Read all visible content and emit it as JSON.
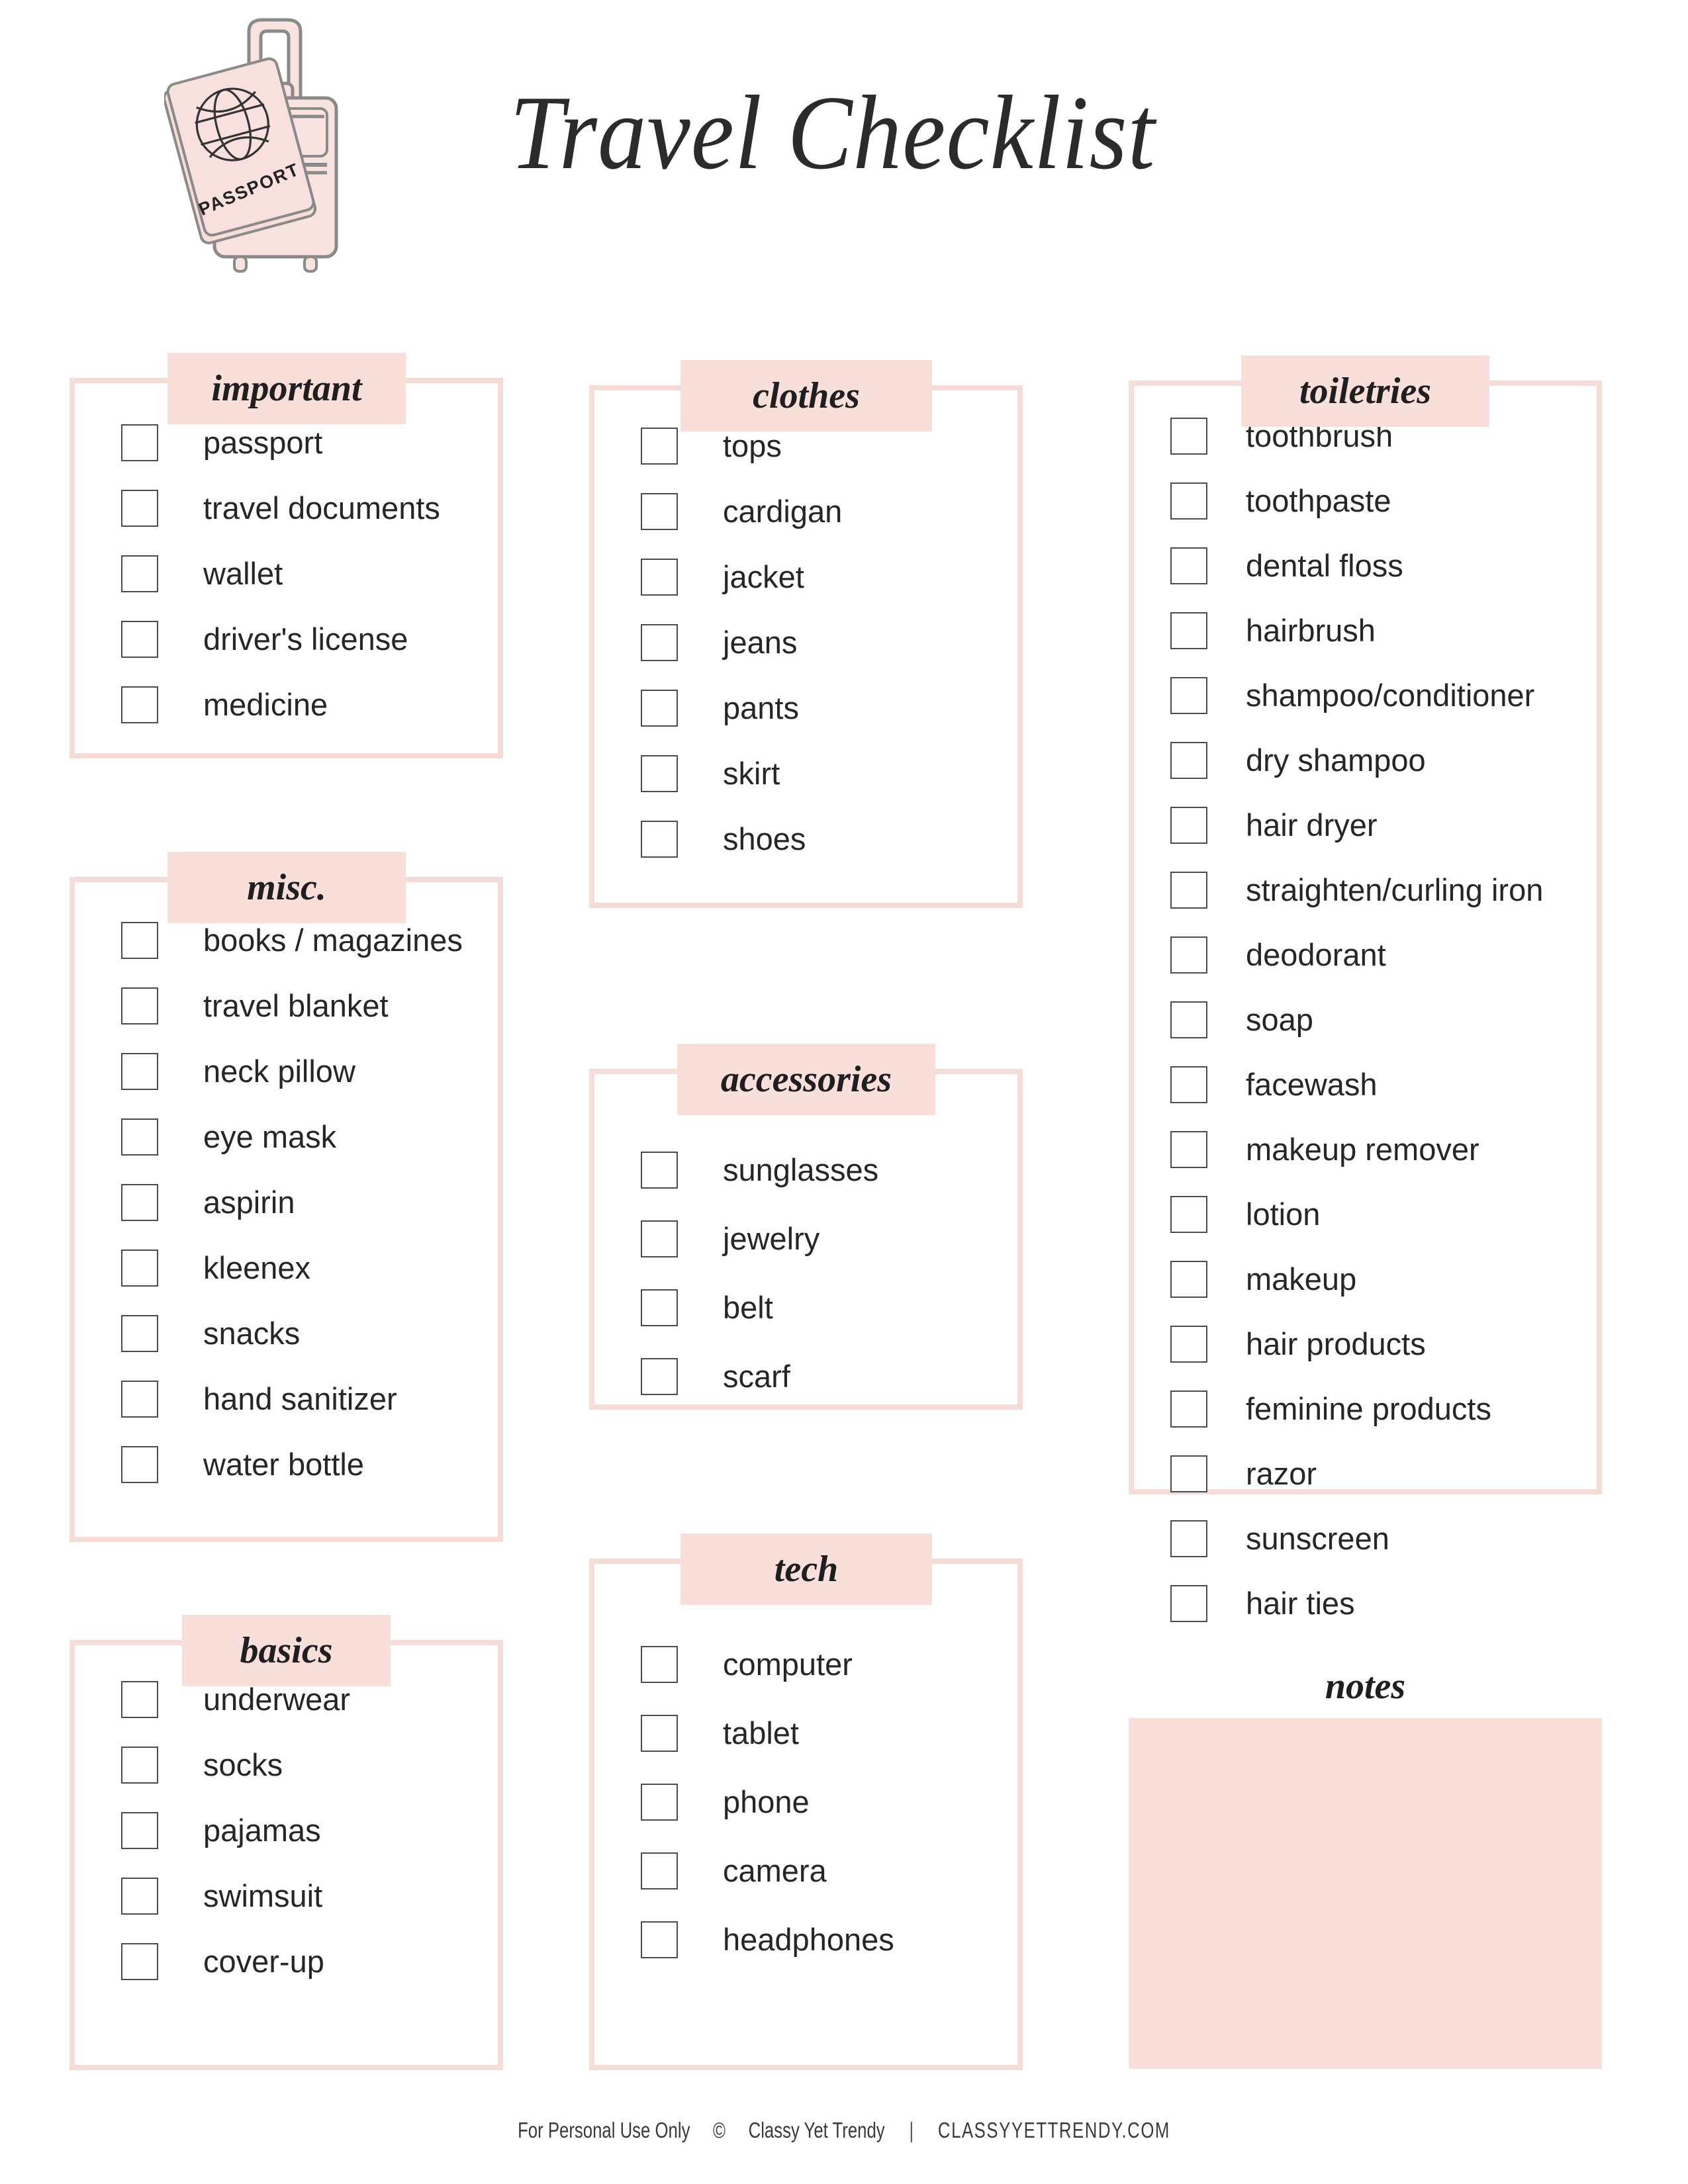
{
  "page": {
    "title": "Travel Checklist",
    "illustration": {
      "name": "passport-suitcase-illustration",
      "passport_label": "PASSPORT"
    }
  },
  "colors": {
    "badge_fill": "#f8dfda",
    "box_border": "#f6dcd7",
    "notes_fill": "#f8dfda",
    "text": "#262626",
    "checkbox_border": "#4a4a4a"
  },
  "sections": [
    {
      "id": "important",
      "title": "important",
      "items": [
        "passport",
        "travel documents",
        "wallet",
        "driver's license",
        "medicine"
      ]
    },
    {
      "id": "misc",
      "title": "misc.",
      "items": [
        "books / magazines",
        "travel blanket",
        "neck pillow",
        "eye mask",
        "aspirin",
        "kleenex",
        "snacks",
        "hand sanitizer",
        "water bottle"
      ]
    },
    {
      "id": "basics",
      "title": "basics",
      "items": [
        "underwear",
        "socks",
        "pajamas",
        "swimsuit",
        "cover-up"
      ]
    },
    {
      "id": "clothes",
      "title": "clothes",
      "items": [
        "tops",
        "cardigan",
        "jacket",
        "jeans",
        "pants",
        "skirt",
        "shoes"
      ]
    },
    {
      "id": "accessories",
      "title": "accessories",
      "items": [
        "sunglasses",
        "jewelry",
        "belt",
        "scarf"
      ]
    },
    {
      "id": "tech",
      "title": "tech",
      "items": [
        "computer",
        "tablet",
        "phone",
        "camera",
        "headphones"
      ]
    },
    {
      "id": "toiletries",
      "title": "toiletries",
      "items": [
        "toothbrush",
        "toothpaste",
        "dental floss",
        "hairbrush",
        "shampoo/conditioner",
        "dry shampoo",
        "hair dryer",
        "straighten/curling iron",
        "deodorant",
        "soap",
        "facewash",
        "makeup remover",
        "lotion",
        "makeup",
        "hair products",
        "feminine products",
        "razor",
        "sunscreen",
        "hair ties"
      ]
    }
  ],
  "notes": {
    "title": "notes"
  },
  "footer": {
    "usage": "For Personal Use Only",
    "copyright_symbol": "©",
    "brand": "Classy Yet Trendy",
    "separator": "|",
    "domain": "CLASSYYETTRENDY.COM"
  }
}
